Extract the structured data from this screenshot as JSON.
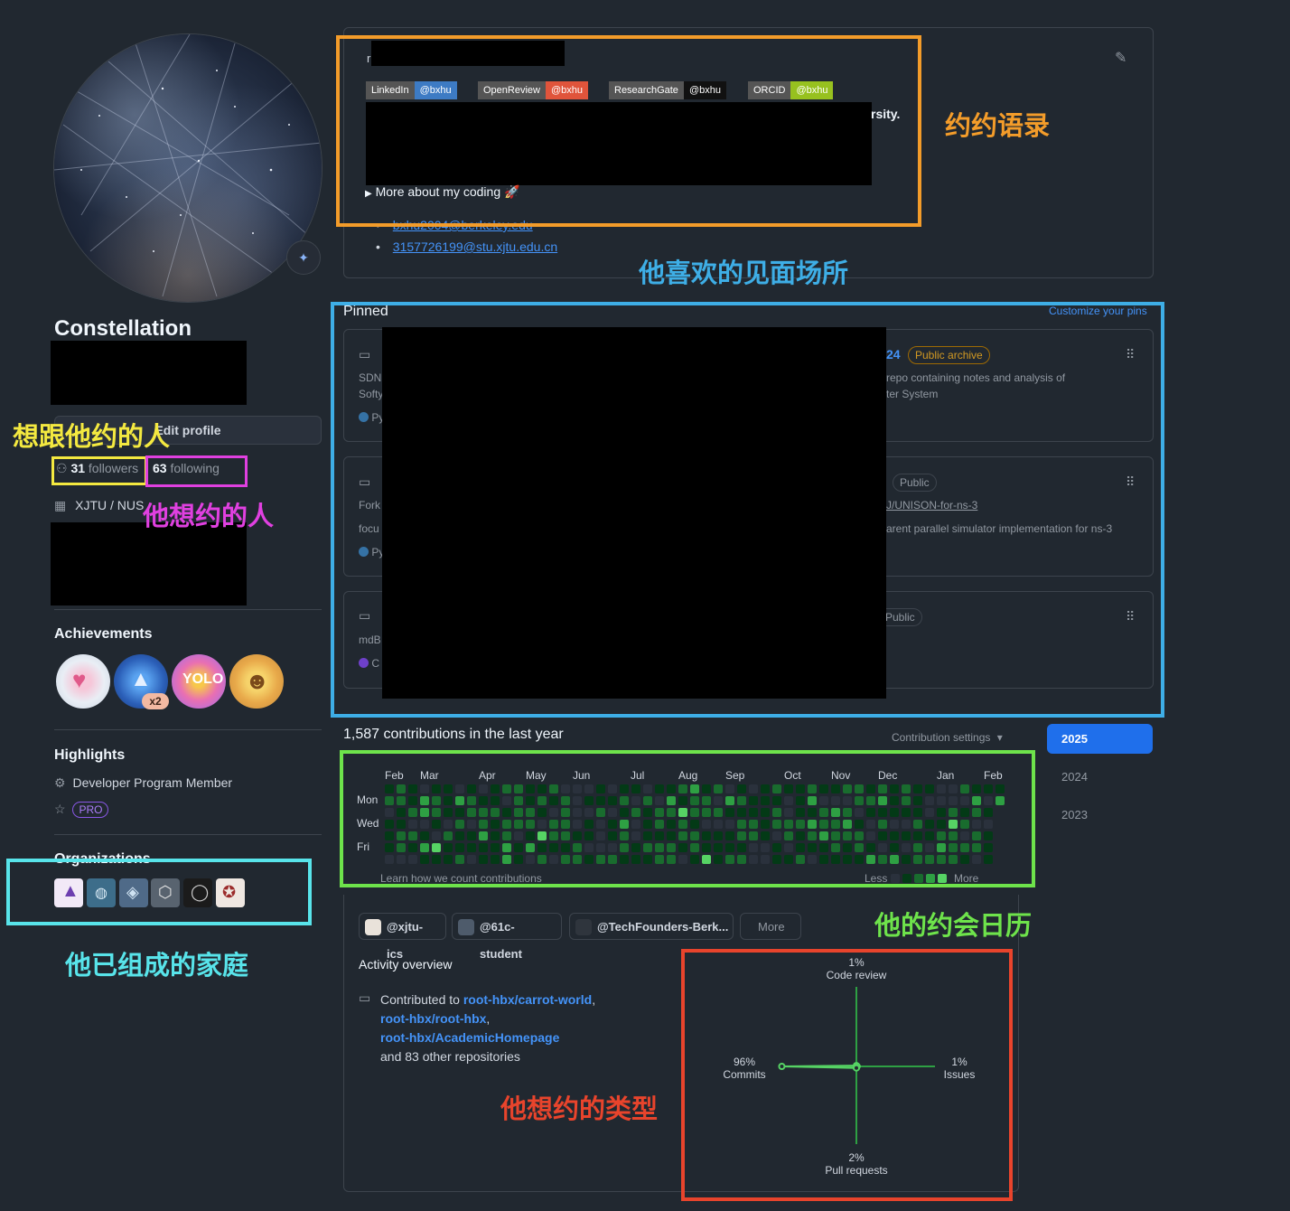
{
  "profile": {
    "name": "Constellation",
    "edit_profile": "Edit profile",
    "followers_count": "31",
    "followers_label": "followers",
    "following_count": "63",
    "following_label": "following",
    "org_line": "XJTU / NUS",
    "status_icon": "status-emoji-icon"
  },
  "achievements": {
    "title": "Achievements",
    "multiplier": "x2",
    "badges": [
      "heart-on-sleeve-badge",
      "pull-shark-badge",
      "yolo-badge",
      "quickdraw-badge"
    ]
  },
  "highlights": {
    "title": "Highlights",
    "items": [
      "Developer Program Member"
    ],
    "pro": "PRO"
  },
  "organizations": {
    "title": "Organizations"
  },
  "readme": {
    "first_char": "r",
    "shields": [
      {
        "label": "LinkedIn",
        "value": "@bxhu",
        "color": "#3d7bc4"
      },
      {
        "label": "OpenReview",
        "value": "@bxhu",
        "color": "#e0543b"
      },
      {
        "label": "ResearchGate",
        "value": "@bxhu",
        "color": "#111111"
      },
      {
        "label": "ORCID",
        "value": "@bxhu",
        "color": "#97c11f"
      }
    ],
    "line_tail": "rsity.",
    "more_about": "More about my coding 🚀",
    "email_1": "bxhu2004@berkeley.edu",
    "email_2": "3157726199@stu.xjtu.edu.cn"
  },
  "pinned": {
    "title": "Pinned",
    "customize": "Customize your pins",
    "cards": [
      {
        "visibility": "Public archive",
        "frag_num": "24",
        "desc_tail_1": "repo containing notes and analysis of",
        "desc_tail_2": "ter System",
        "left_1": "SDN",
        "left_2": "Softy",
        "lang_frag": "Py",
        "lang_color": "#3572A5"
      },
      {
        "visibility": "Public",
        "link_tail": "J/UNISON-for-ns-3",
        "desc_tail_1": "arent parallel simulator implementation for ns-3",
        "left_1": "Fork",
        "left_2": "focu",
        "lang_frag": "Py",
        "lang_color": "#3572A5"
      },
      {
        "visibility": "Public",
        "left_1": "mdB",
        "lang_frag": "C",
        "lang_color": "#6e40c9"
      }
    ]
  },
  "contributions": {
    "summary": "1,587 contributions in the last year",
    "settings": "Contribution settings",
    "months": [
      "Feb",
      "Mar",
      "Apr",
      "May",
      "Jun",
      "Jul",
      "Aug",
      "Sep",
      "Oct",
      "Nov",
      "Dec",
      "Jan",
      "Feb"
    ],
    "days": [
      "Mon",
      "Wed",
      "Fri"
    ],
    "learn": "Learn how we count contributions",
    "less": "Less",
    "more": "More",
    "years": [
      "2025",
      "2024",
      "2023"
    ],
    "selected_year": "2025"
  },
  "activity": {
    "orgs": [
      "@xjtu-ics",
      "@61c-student",
      "@TechFounders-Berk..."
    ],
    "more": "More",
    "title": "Activity overview",
    "contributed_to": "Contributed to",
    "repo_1": "root-hbx/carrot-world",
    "repo_2": "root-hbx/root-hbx",
    "repo_3": "root-hbx/AcademicHomepage",
    "others": "and 83 other repositories",
    "radar": {
      "code_review_pct": "1%",
      "code_review": "Code review",
      "commits_pct": "96%",
      "commits": "Commits",
      "issues_pct": "1%",
      "issues": "Issues",
      "pr_pct": "2%",
      "pr": "Pull requests",
      "values": {
        "code_review": 1,
        "commits": 96,
        "issues": 1,
        "pull_requests": 2
      }
    }
  },
  "annotations": {
    "quote": "约约语录",
    "meet_place": "他喜欢的见面场所",
    "followers": "想跟他约的人",
    "following": "他想约的人",
    "calendar": "他的约会日历",
    "types": "他想约的类型",
    "family": "他已组成的家庭",
    "colors": {
      "orange": "#f39c2a",
      "blue": "#3eaee6",
      "yellow": "#f4e940",
      "magenta": "#e040e0",
      "green": "#6ee34b",
      "red": "#e8442c",
      "cyan": "#58e4ea"
    }
  }
}
